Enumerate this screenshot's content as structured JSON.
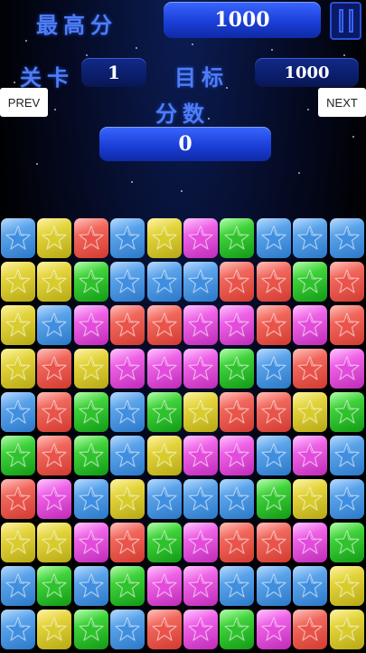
{
  "header": {
    "best_label": "最高分",
    "best_score": "1000",
    "level_label": "关卡",
    "level_value": "1",
    "target_label": "目标",
    "target_value": "1000",
    "score_label": "分数",
    "score_value": "0"
  },
  "nav": {
    "prev": "PREV",
    "next": "NEXT"
  },
  "colors": {
    "B": "#3f8ee0",
    "Y": "#d8cc2c",
    "R": "#e9534a",
    "G": "#2fc22d",
    "P": "#e24bdb"
  },
  "board": {
    "rows": [
      [
        "B",
        "Y",
        "R",
        "B",
        "Y",
        "P",
        "G",
        "B",
        "B",
        "B"
      ],
      [
        "Y",
        "Y",
        "G",
        "B",
        "B",
        "B",
        "R",
        "R",
        "G",
        "R"
      ],
      [
        "Y",
        "B",
        "P",
        "R",
        "R",
        "P",
        "P",
        "R",
        "P",
        "R"
      ],
      [
        "Y",
        "R",
        "Y",
        "P",
        "P",
        "P",
        "G",
        "B",
        "R",
        "P"
      ],
      [
        "B",
        "R",
        "G",
        "B",
        "G",
        "Y",
        "R",
        "R",
        "Y",
        "G"
      ],
      [
        "G",
        "R",
        "G",
        "B",
        "Y",
        "P",
        "P",
        "B",
        "P",
        "B"
      ],
      [
        "R",
        "P",
        "B",
        "Y",
        "B",
        "B",
        "B",
        "G",
        "Y",
        "B"
      ],
      [
        "Y",
        "Y",
        "P",
        "R",
        "G",
        "P",
        "R",
        "R",
        "P",
        "G"
      ],
      [
        "B",
        "G",
        "B",
        "G",
        "P",
        "P",
        "B",
        "B",
        "B",
        "Y"
      ],
      [
        "B",
        "Y",
        "G",
        "B",
        "R",
        "P",
        "G",
        "P",
        "R",
        "Y"
      ]
    ]
  }
}
